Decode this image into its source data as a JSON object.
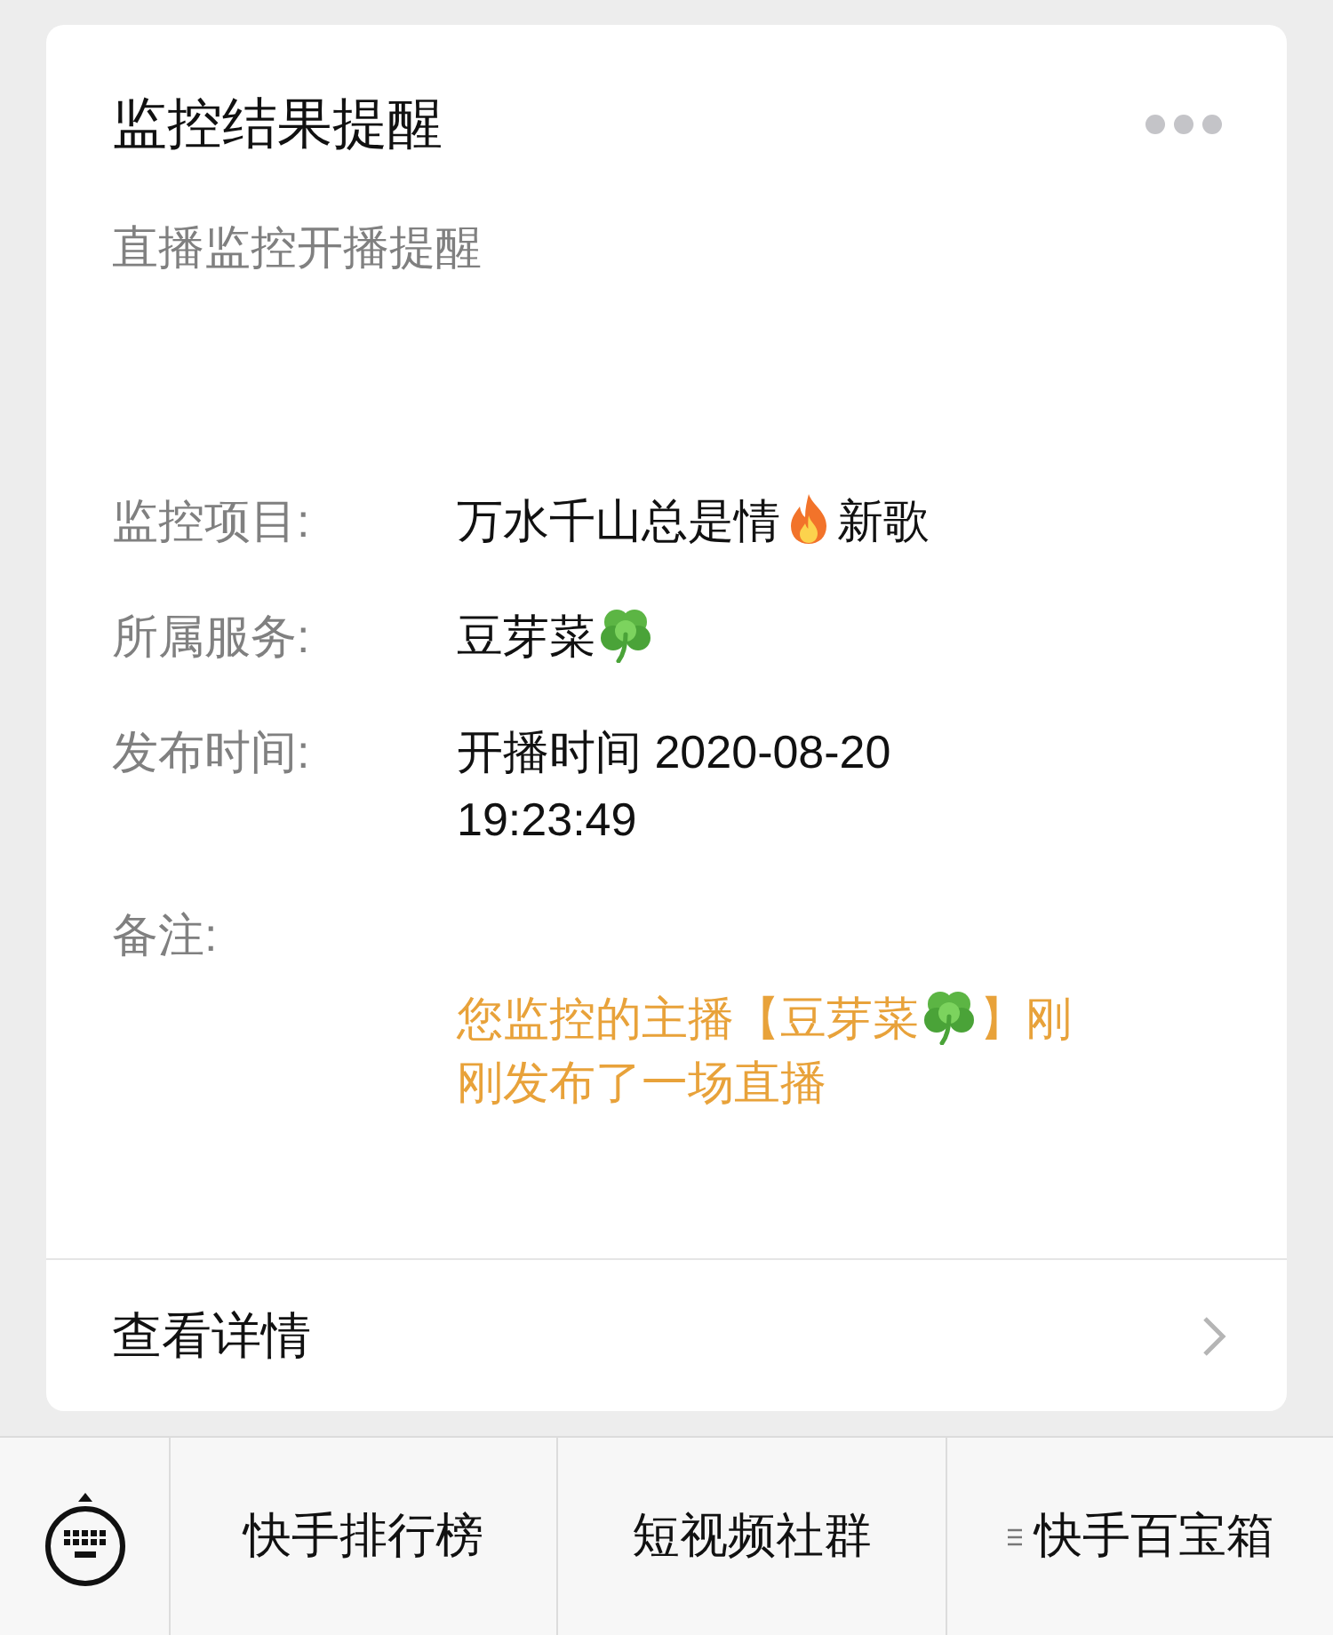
{
  "card": {
    "title": "监控结果提醒",
    "subtitle": "直播监控开播提醒",
    "fields": [
      {
        "label": "监控项目:",
        "parts": [
          {
            "kind": "text",
            "text": "万水千山总是情"
          },
          {
            "kind": "fire"
          },
          {
            "kind": "text",
            "text": "新歌"
          }
        ]
      },
      {
        "label": "所属服务:",
        "parts": [
          {
            "kind": "text",
            "text": "豆芽菜"
          },
          {
            "kind": "clover"
          }
        ]
      },
      {
        "label": "发布时间:",
        "parts": [
          {
            "kind": "text",
            "text": "开播时间 2020-08-20 19:23:49"
          }
        ]
      }
    ],
    "note": {
      "label": "备注:",
      "parts": [
        {
          "kind": "text",
          "text": "您监控的主播【豆芽菜"
        },
        {
          "kind": "clover"
        },
        {
          "kind": "text",
          "text": "】刚"
        },
        {
          "kind": "text",
          "text": "刚发布了一场直播"
        }
      ]
    },
    "link": "查看详情"
  },
  "menu": [
    {
      "label": "快手排行榜",
      "submenu": false
    },
    {
      "label": "短视频社群",
      "submenu": false
    },
    {
      "label": "快手百宝箱",
      "submenu": true
    }
  ]
}
